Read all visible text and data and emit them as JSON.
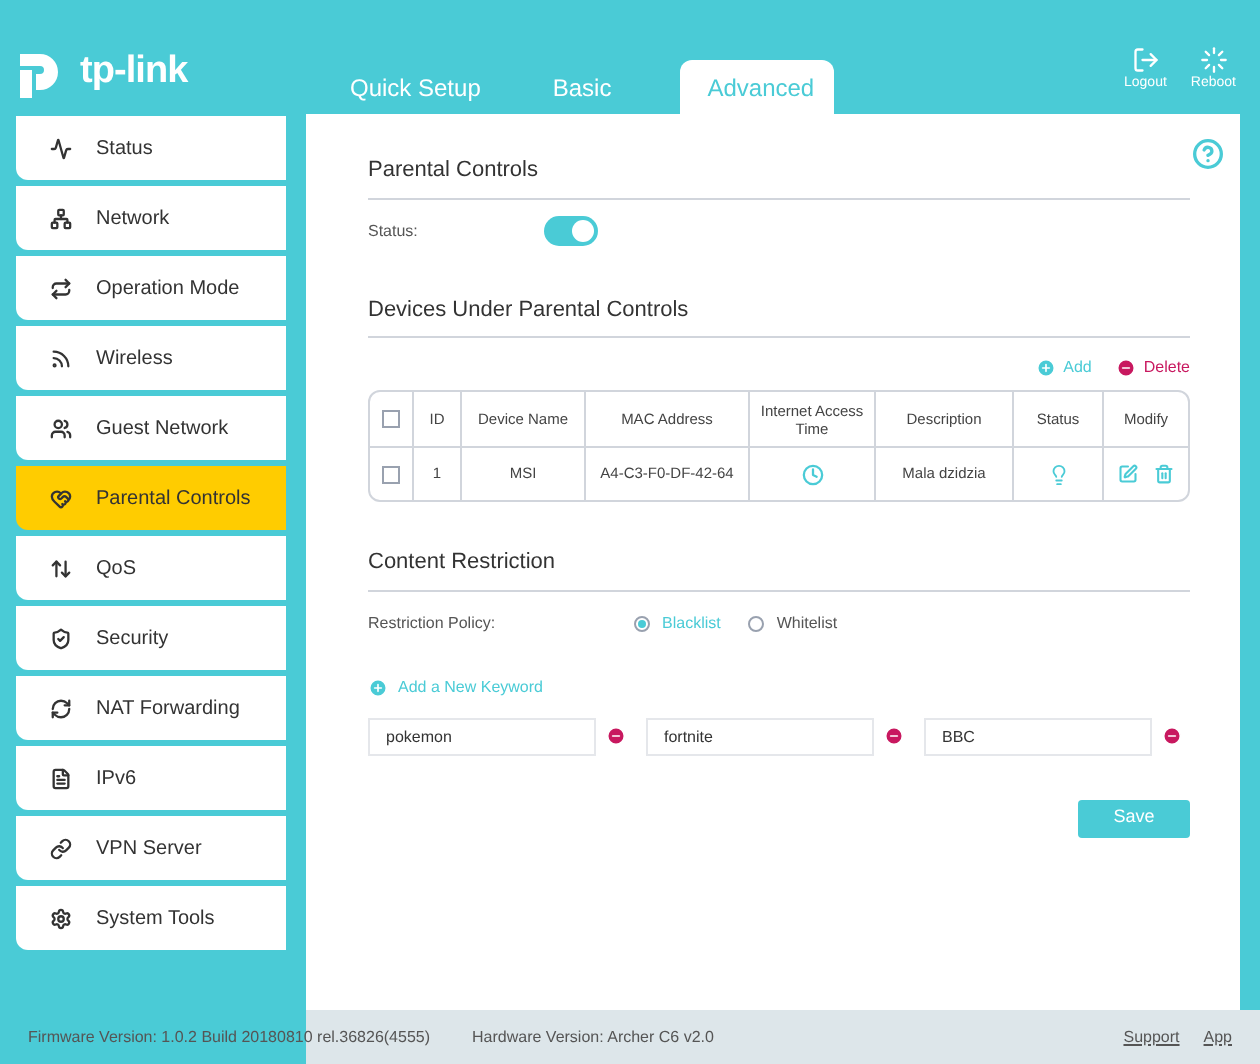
{
  "header": {
    "logo": "tp-link",
    "tabs": [
      {
        "label": "Quick Setup",
        "selected": false
      },
      {
        "label": "Basic",
        "selected": false
      },
      {
        "label": "Advanced",
        "selected": true
      }
    ],
    "actions": [
      {
        "kind": "logout",
        "label": "Logout"
      },
      {
        "kind": "reboot",
        "label": "Reboot"
      }
    ]
  },
  "sidebar": {
    "items": [
      {
        "label": "Status",
        "selected": false
      },
      {
        "label": "Network",
        "selected": false
      },
      {
        "label": "Operation Mode",
        "selected": false
      },
      {
        "label": "Wireless",
        "selected": false
      },
      {
        "label": "Guest Network",
        "selected": false
      },
      {
        "label": "Parental Controls",
        "selected": true
      },
      {
        "label": "QoS",
        "selected": false
      },
      {
        "label": "Security",
        "selected": false
      },
      {
        "label": "NAT Forwarding",
        "selected": false
      },
      {
        "label": "IPv6",
        "selected": false
      },
      {
        "label": "VPN Server",
        "selected": false
      },
      {
        "label": "System Tools",
        "selected": false
      }
    ]
  },
  "parental_controls": {
    "title": "Parental Controls",
    "status_label": "Status:",
    "on": true
  },
  "devices": {
    "title": "Devices Under Parental Controls",
    "add": "Add",
    "delete": "Delete",
    "columns": [
      "ID",
      "Device Name",
      "MAC Address",
      "Internet Access Time",
      "Description",
      "Status",
      "Modify"
    ],
    "select_all_checked": false,
    "rows": [
      {
        "checked": false,
        "id": "1",
        "device_name": "MSI",
        "mac": "A4-C3-F0-DF-42-64",
        "description": "Mala dzidzia"
      }
    ]
  },
  "content_restriction": {
    "title": "Content Restriction",
    "policy_label": "Restriction Policy:",
    "options": [
      {
        "label": "Blacklist",
        "selected": true
      },
      {
        "label": "Whitelist",
        "selected": false
      }
    ],
    "add_keyword": "Add a New Keyword",
    "keywords": [
      "pokemon",
      "fortnite",
      "BBC"
    ]
  },
  "save": "Save",
  "footer": {
    "firmware": "Firmware Version: 1.0.2 Build 20180810 rel.36826(4555)",
    "hardware": "Hardware Version: Archer C6 v2.0",
    "links": [
      "Support",
      "App"
    ]
  }
}
